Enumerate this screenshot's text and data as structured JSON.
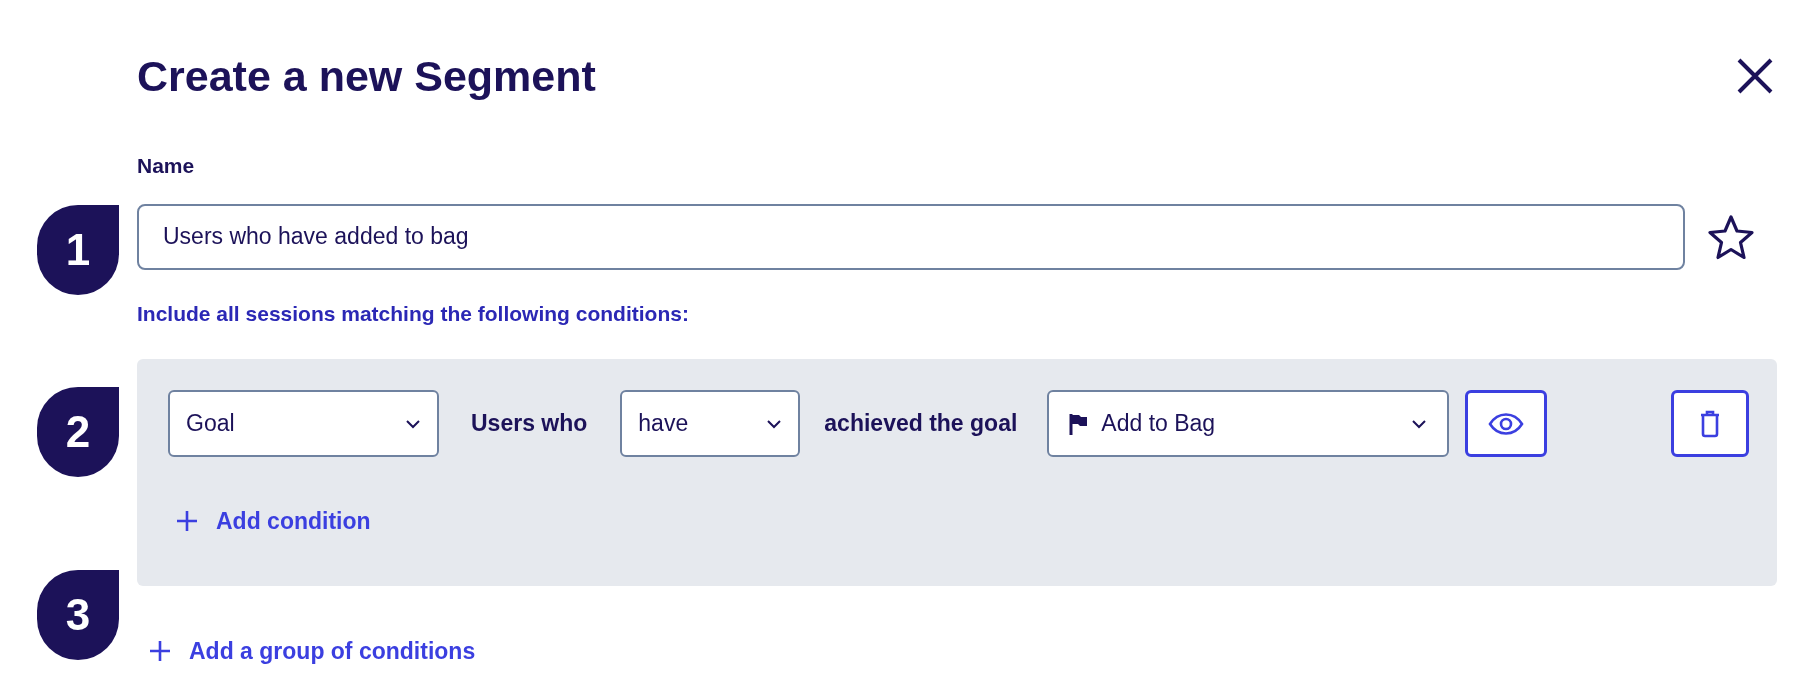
{
  "title": "Create a new Segment",
  "steps": [
    "1",
    "2",
    "3"
  ],
  "name_field": {
    "label": "Name",
    "value": "Users who have added to bag",
    "favorite": false
  },
  "instructions": "Include all sessions matching the following conditions:",
  "conditions": [
    {
      "type": "Goal",
      "text_1": "Users who",
      "operator": "have",
      "text_2": "achieved the goal",
      "goal": "Add to Bag"
    }
  ],
  "add_condition": "Add condition",
  "add_group": "Add a group of conditions"
}
